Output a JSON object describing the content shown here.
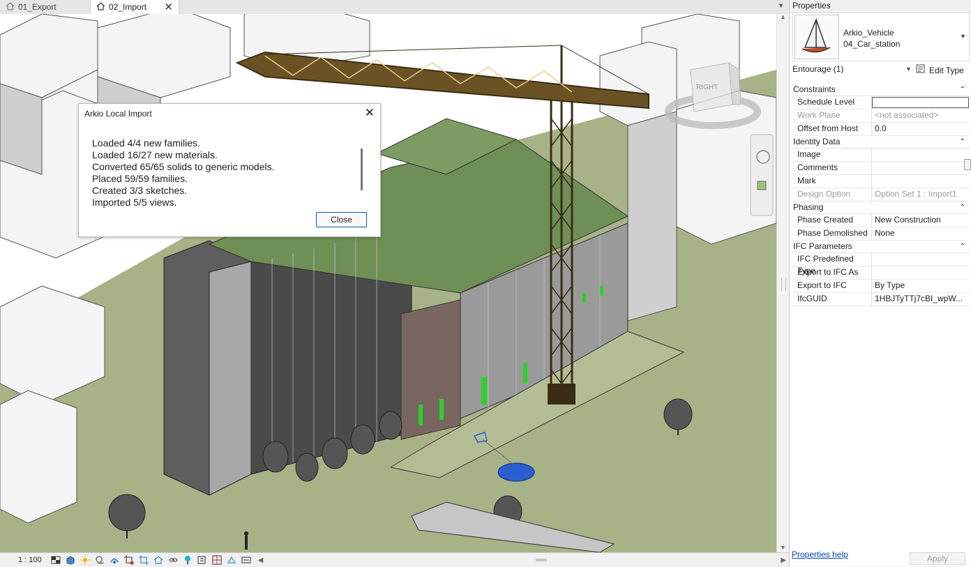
{
  "tabs": [
    {
      "label": "01_Export",
      "active": false
    },
    {
      "label": "02_Import",
      "active": true
    }
  ],
  "dialog": {
    "title": "Arkio Local Import",
    "lines": [
      "Loaded 4/4 new families.",
      "Loaded 16/27 new materials.",
      "Converted 65/65 solids to generic models.",
      "Placed 59/59 families.",
      "Created 3/3 sketches.",
      "Imported 5/5 views."
    ],
    "close_label": "Close"
  },
  "viewcube": {
    "face_label": "RIGHT"
  },
  "statusbar": {
    "scale": "1 : 100"
  },
  "properties": {
    "title": "Properties",
    "type_name_line1": "Arkio_Vehicle",
    "type_name_line2": "04_Car_station",
    "instance_filter": "Entourage (1)",
    "edit_type_label": "Edit Type",
    "groups": {
      "constraints": {
        "label": "Constraints",
        "rows": [
          {
            "k": "Schedule Level",
            "v": ""
          },
          {
            "k": "Work Plane",
            "v": "<not associated>"
          },
          {
            "k": "Offset from Host",
            "v": "0.0"
          }
        ]
      },
      "identity": {
        "label": "Identity Data",
        "rows": [
          {
            "k": "Image",
            "v": ""
          },
          {
            "k": "Comments",
            "v": ""
          },
          {
            "k": "Mark",
            "v": ""
          },
          {
            "k": "Design Option",
            "v": "Option Set 1 : Import1"
          }
        ]
      },
      "phasing": {
        "label": "Phasing",
        "rows": [
          {
            "k": "Phase Created",
            "v": "New Construction"
          },
          {
            "k": "Phase Demolished",
            "v": "None"
          }
        ]
      },
      "ifc": {
        "label": "IFC Parameters",
        "rows": [
          {
            "k": "IFC Predefined Type",
            "v": ""
          },
          {
            "k": "Export to IFC As",
            "v": ""
          },
          {
            "k": "Export to IFC",
            "v": "By Type"
          },
          {
            "k": "IfcGUID",
            "v": "1HBJTyTTj7cBI_wpW..."
          }
        ]
      }
    },
    "help_label": "Properties help",
    "apply_label": "Apply"
  },
  "colors": {
    "sky": "#ffffff",
    "ground": "#a8b589",
    "building": "#d9d9d9",
    "crane": "#5c4a2a",
    "accent": "#0d57b3",
    "selection": "#2a5fd0"
  }
}
